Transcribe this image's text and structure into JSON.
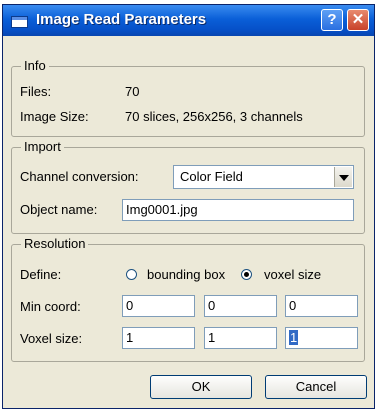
{
  "window": {
    "title": "Image Read Parameters",
    "help_label": "?",
    "close_label": "✕"
  },
  "info": {
    "legend": "Info",
    "files_label": "Files:",
    "files_value": "70",
    "size_label": "Image Size:",
    "size_value": "70 slices, 256x256, 3 channels"
  },
  "import": {
    "legend": "Import",
    "channel_label": "Channel conversion:",
    "channel_value": "Color Field",
    "object_label": "Object name:",
    "object_value": "Img0001.jpg"
  },
  "resolution": {
    "legend": "Resolution",
    "define_label": "Define:",
    "option_bbox": "bounding box",
    "option_voxel": "voxel size",
    "selected_option": "voxel size",
    "min_label": "Min coord:",
    "min_values": [
      "0",
      "0",
      "0"
    ],
    "voxel_label": "Voxel size:",
    "voxel_values": [
      "1",
      "1",
      "1"
    ]
  },
  "buttons": {
    "ok": "OK",
    "cancel": "Cancel"
  }
}
